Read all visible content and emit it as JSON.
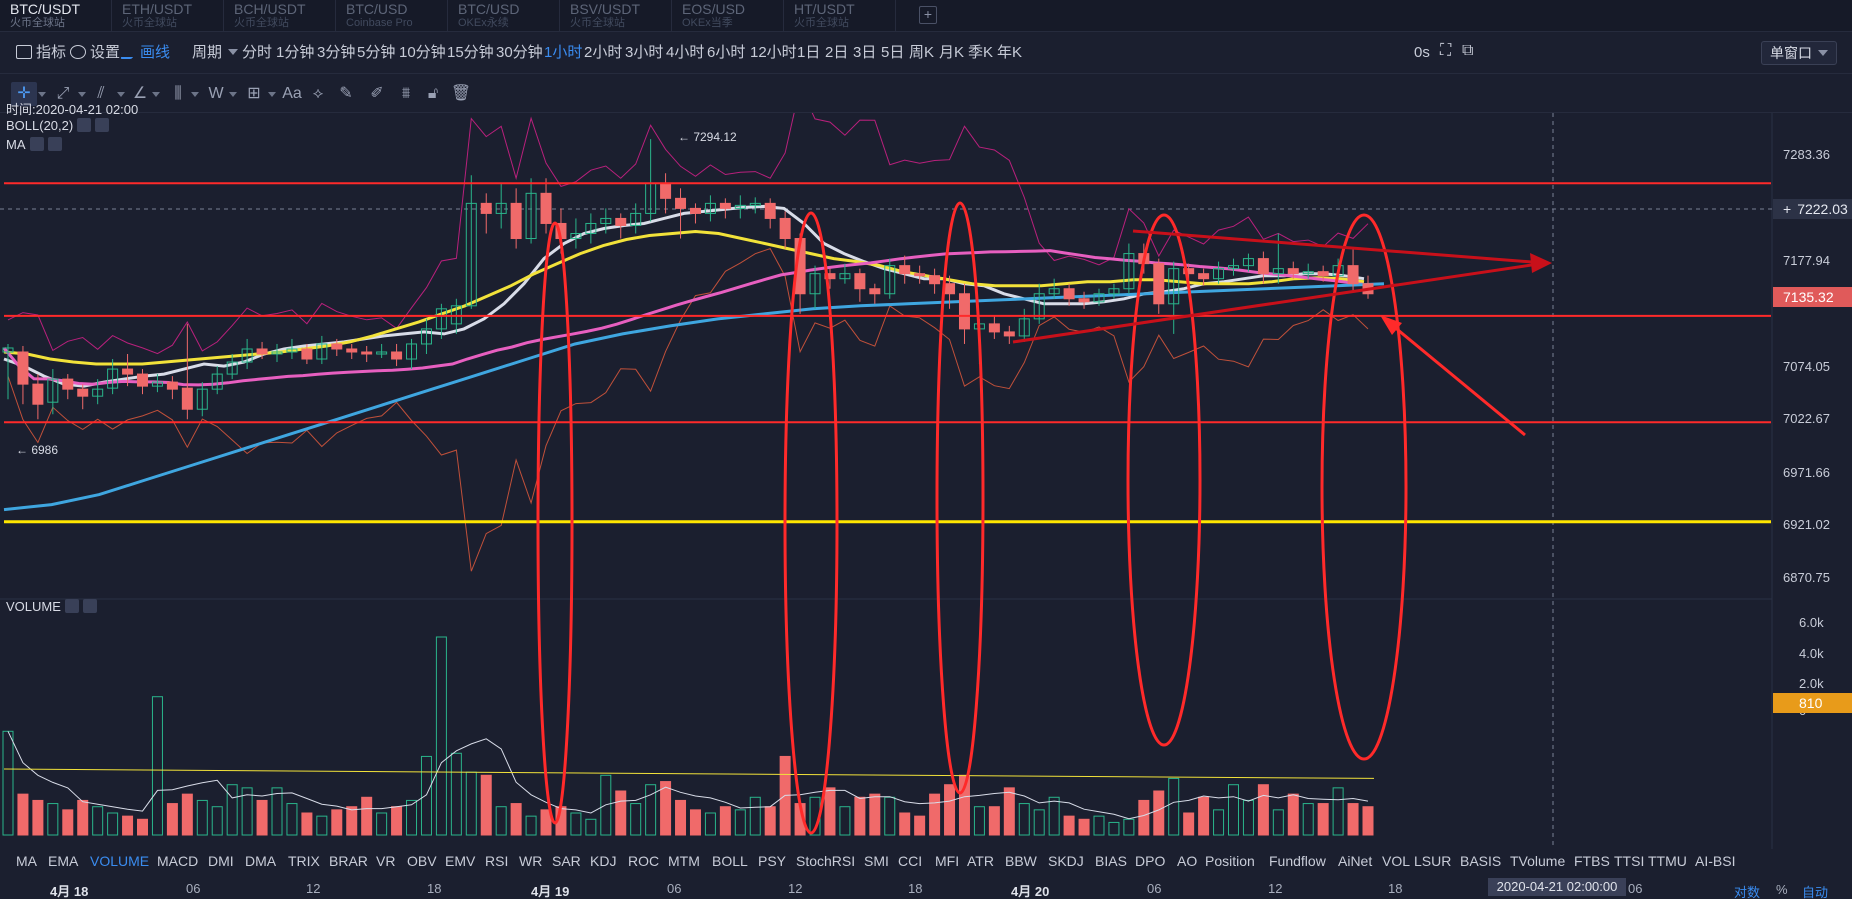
{
  "pair_tabs": [
    {
      "name": "BTC/USDT",
      "sub": "火币全球站",
      "active": true
    },
    {
      "name": "ETH/USDT",
      "sub": "火币全球站",
      "active": false
    },
    {
      "name": "BCH/USDT",
      "sub": "火币全球站",
      "active": false
    },
    {
      "name": "BTC/USD",
      "sub": "Coinbase Pro",
      "active": false
    },
    {
      "name": "BTC/USD",
      "sub": "OKEx永续",
      "active": false
    },
    {
      "name": "BSV/USDT",
      "sub": "火币全球站",
      "active": false
    },
    {
      "name": "EOS/USD",
      "sub": "OKEx当季",
      "active": false
    },
    {
      "name": "HT/USDT",
      "sub": "火币全球站",
      "active": false
    }
  ],
  "add_tab_label": "+",
  "toolbar": {
    "indicators_label": "指标",
    "settings_label": "设置",
    "draw_label": "画线",
    "period_label": "周期",
    "intervals": [
      "分时",
      "1分钟",
      "3分钟",
      "5分钟",
      "10分钟",
      "15分钟",
      "30分钟",
      "1小时",
      "2小时",
      "3小时",
      "4小时",
      "6小时",
      "12小时",
      "1日",
      "2日",
      "3日",
      "5日",
      "周K",
      "月K",
      "季K",
      "年K"
    ],
    "active_interval": "1小时",
    "countdown": "0s",
    "layout_label": "单窗口"
  },
  "draw_tools": [
    "crosshair",
    "trend-line",
    "parallel-lines",
    "angle",
    "candle-pattern",
    "wave",
    "measure",
    "text",
    "shapes",
    "ruler",
    "brush",
    "fibonacci",
    "lock",
    "trash"
  ],
  "overlay": {
    "time_label": "时间:2020-04-21 02:00",
    "boll_label": "BOLL(20,2)",
    "ma_label": "MA",
    "volume_label": "VOLUME",
    "high_label": "← 7294.12",
    "low_label": "← 6986"
  },
  "price_axis": {
    "ticks": [
      "7283.36",
      "7230.46",
      "7177.94",
      "7125.31",
      "7074.05",
      "7022.67",
      "6971.66",
      "6921.02",
      "6870.75"
    ],
    "cursor_price": "7222.03",
    "last_price": "7135.32",
    "volume_ticks": [
      "6.0k",
      "4.0k",
      "2.0k",
      "0"
    ],
    "volume_badge": "810"
  },
  "indicator_tabs": [
    "MA",
    "EMA",
    "VOLUME",
    "MACD",
    "DMI",
    "DMA",
    "TRIX",
    "BRAR",
    "VR",
    "OBV",
    "EMV",
    "RSI",
    "WR",
    "SAR",
    "KDJ",
    "ROC",
    "MTM",
    "BOLL",
    "PSY",
    "StochRSI",
    "SMI",
    "CCI",
    "MFI",
    "ATR",
    "BBW",
    "SKDJ",
    "BIAS",
    "DPO",
    "AO",
    "Position",
    "Fundflow",
    "AiNet",
    "VOL",
    "LSUR",
    "BASIS",
    "TVolume",
    "FTBS",
    "TTSI",
    "TTMU",
    "AI-BSI"
  ],
  "active_indicator": "VOLUME",
  "time_axis": {
    "ticks": [
      "4月 18",
      "06",
      "12",
      "18",
      "4月 19",
      "06",
      "12",
      "18",
      "4月 20",
      "06",
      "12",
      "18",
      "06"
    ],
    "cursor_time": "2020-04-21 02:00:00",
    "log_label": "对数",
    "percent_label": "%",
    "auto_label": "自动"
  },
  "colors": {
    "background": "#1b1f2f",
    "up": "#2ab58b",
    "down": "#f06a6a",
    "accent": "#3a8cf0",
    "annotation": "#ff2a2a",
    "ma_white": "#d8dce8",
    "ma_yellow": "#f2e23a",
    "ma_pink": "#e75fc0",
    "ma_blue": "#3fa6e0",
    "boll": "#b8207c"
  },
  "chart_data": {
    "type": "candlestick",
    "interval": "1小时",
    "price_range": [
      6840,
      7320
    ],
    "candles": [
      [
        7082,
        7086,
        7035,
        7090
      ],
      [
        7082,
        7050,
        7030,
        7088
      ],
      [
        7050,
        7030,
        7015,
        7060
      ],
      [
        7032,
        7055,
        7020,
        7065
      ],
      [
        7055,
        7045,
        7035,
        7060
      ],
      [
        7045,
        7038,
        7025,
        7050
      ],
      [
        7038,
        7045,
        7030,
        7055
      ],
      [
        7046,
        7065,
        7040,
        7075
      ],
      [
        7065,
        7060,
        7048,
        7080
      ],
      [
        7060,
        7048,
        7040,
        7065
      ],
      [
        7048,
        7052,
        7042,
        7060
      ],
      [
        7052,
        7045,
        7035,
        7058
      ],
      [
        7046,
        7025,
        7015,
        7110
      ],
      [
        7025,
        7045,
        7018,
        7052
      ],
      [
        7045,
        7060,
        7040,
        7068
      ],
      [
        7060,
        7072,
        7055,
        7080
      ],
      [
        7072,
        7085,
        7065,
        7095
      ],
      [
        7085,
        7080,
        7075,
        7092
      ],
      [
        7080,
        7082,
        7072,
        7090
      ],
      [
        7082,
        7085,
        7075,
        7095
      ],
      [
        7085,
        7075,
        7070,
        7090
      ],
      [
        7075,
        7090,
        7070,
        7098
      ],
      [
        7090,
        7085,
        7078,
        7095
      ],
      [
        7085,
        7082,
        7075,
        7090
      ],
      [
        7082,
        7080,
        7072,
        7088
      ],
      [
        7080,
        7082,
        7076,
        7090
      ],
      [
        7082,
        7075,
        7068,
        7090
      ],
      [
        7075,
        7090,
        7065,
        7095
      ],
      [
        7090,
        7105,
        7080,
        7115
      ],
      [
        7105,
        7125,
        7095,
        7130
      ],
      [
        7110,
        7128,
        7100,
        7135
      ],
      [
        7128,
        7230,
        7125,
        7258
      ],
      [
        7230,
        7220,
        7200,
        7240
      ],
      [
        7220,
        7230,
        7205,
        7250
      ],
      [
        7230,
        7195,
        7185,
        7245
      ],
      [
        7195,
        7240,
        7190,
        7255
      ],
      [
        7240,
        7210,
        7200,
        7255
      ],
      [
        7210,
        7195,
        7180,
        7225
      ],
      [
        7195,
        7200,
        7185,
        7215
      ],
      [
        7200,
        7210,
        7190,
        7220
      ],
      [
        7210,
        7215,
        7200,
        7225
      ],
      [
        7215,
        7208,
        7195,
        7220
      ],
      [
        7208,
        7220,
        7200,
        7230
      ],
      [
        7220,
        7250,
        7212,
        7294
      ],
      [
        7250,
        7235,
        7220,
        7260
      ],
      [
        7235,
        7225,
        7195,
        7245
      ],
      [
        7225,
        7220,
        7210,
        7230
      ],
      [
        7220,
        7230,
        7212,
        7238
      ],
      [
        7230,
        7225,
        7215,
        7235
      ],
      [
        7225,
        7228,
        7215,
        7238
      ],
      [
        7228,
        7230,
        7220,
        7236
      ],
      [
        7230,
        7215,
        7205,
        7235
      ],
      [
        7215,
        7195,
        7185,
        7222
      ],
      [
        7195,
        7140,
        7120,
        7200
      ],
      [
        7140,
        7160,
        7125,
        7168
      ],
      [
        7160,
        7155,
        7145,
        7165
      ],
      [
        7155,
        7160,
        7150,
        7170
      ],
      [
        7160,
        7145,
        7132,
        7165
      ],
      [
        7145,
        7140,
        7130,
        7150
      ],
      [
        7140,
        7168,
        7135,
        7175
      ],
      [
        7168,
        7160,
        7150,
        7178
      ],
      [
        7160,
        7158,
        7150,
        7168
      ],
      [
        7158,
        7150,
        7140,
        7165
      ],
      [
        7150,
        7140,
        7125,
        7158
      ],
      [
        7140,
        7105,
        7090,
        7150
      ],
      [
        7105,
        7110,
        7070,
        7115
      ],
      [
        7110,
        7102,
        7095,
        7118
      ],
      [
        7102,
        7098,
        7090,
        7108
      ],
      [
        7098,
        7115,
        7092,
        7125
      ],
      [
        7115,
        7140,
        7110,
        7150
      ],
      [
        7140,
        7145,
        7135,
        7155
      ],
      [
        7145,
        7135,
        7128,
        7150
      ],
      [
        7135,
        7132,
        7125,
        7142
      ],
      [
        7132,
        7140,
        7128,
        7145
      ],
      [
        7140,
        7145,
        7135,
        7150
      ],
      [
        7145,
        7180,
        7140,
        7190
      ],
      [
        7180,
        7170,
        7160,
        7190
      ],
      [
        7170,
        7130,
        7120,
        7175
      ],
      [
        7130,
        7165,
        7100,
        7172
      ],
      [
        7165,
        7160,
        7150,
        7170
      ],
      [
        7160,
        7155,
        7148,
        7165
      ],
      [
        7155,
        7165,
        7150,
        7172
      ],
      [
        7165,
        7168,
        7158,
        7175
      ],
      [
        7168,
        7175,
        7162,
        7180
      ],
      [
        7175,
        7160,
        7150,
        7182
      ],
      [
        7160,
        7165,
        7150,
        7200
      ],
      [
        7165,
        7160,
        7155,
        7172
      ],
      [
        7160,
        7162,
        7155,
        7170
      ],
      [
        7162,
        7158,
        7152,
        7168
      ],
      [
        7158,
        7168,
        7154,
        7175
      ],
      [
        7168,
        7150,
        7142,
        7185
      ],
      [
        7150,
        7140,
        7135,
        7158
      ]
    ],
    "volume_k": [
      3.3,
      1.3,
      1.1,
      1.0,
      0.8,
      1.1,
      0.9,
      0.7,
      0.6,
      0.5,
      4.4,
      1.0,
      1.3,
      1.1,
      0.9,
      1.6,
      1.5,
      1.1,
      1.5,
      1.0,
      0.7,
      0.6,
      0.8,
      0.9,
      1.2,
      0.7,
      0.9,
      1.1,
      2.5,
      6.3,
      2.6,
      2.0,
      1.9,
      0.9,
      1.0,
      0.6,
      0.8,
      0.9,
      0.7,
      0.5,
      1.9,
      1.4,
      1.0,
      1.6,
      1.7,
      1.1,
      0.8,
      0.7,
      0.9,
      0.8,
      1.2,
      0.9,
      2.5,
      1.0,
      1.2,
      1.5,
      0.9,
      1.2,
      1.3,
      1.2,
      0.7,
      0.6,
      1.3,
      1.6,
      1.9,
      0.9,
      0.9,
      1.5,
      1.0,
      0.8,
      1.2,
      0.6,
      0.5,
      0.6,
      0.4,
      0.5,
      1.1,
      1.4,
      1.8,
      0.7,
      1.2,
      0.8,
      1.6,
      1.1,
      1.6,
      0.8,
      1.3,
      1.0,
      1.0,
      1.5,
      1.0,
      0.9
    ],
    "series": [
      {
        "type": "line",
        "values": [
          7075,
          7068,
          7058,
          7050,
          7048,
          7052,
          7055,
          7058,
          7060,
          7065,
          7070,
          7068,
          7072,
          7080,
          7085,
          7088,
          7090,
          7092,
          7095,
          7098,
          7100,
          7102,
          7100,
          7105,
          7115,
          7130,
          7150,
          7175,
          7190,
          7200,
          7205,
          7208,
          7210,
          7215,
          7220,
          7222,
          7224,
          7226,
          7227,
          7225,
          7210,
          7190,
          7180,
          7172,
          7165,
          7160,
          7155,
          7155,
          7150,
          7148,
          7140,
          7135,
          7130,
          7130,
          7130,
          7132,
          7135,
          7140,
          7142,
          7145,
          7150,
          7152,
          7155,
          7158,
          7158,
          7160,
          7160,
          7158,
          7155
        ]
      },
      {
        "type": "line",
        "values": [
          7082,
          7080,
          7075,
          7072,
          7070,
          7070,
          7070,
          7072,
          7074,
          7076,
          7078,
          7080,
          7082,
          7085,
          7088,
          7092,
          7098,
          7105,
          7112,
          7120,
          7128,
          7138,
          7148,
          7160,
          7170,
          7180,
          7188,
          7194,
          7198,
          7200,
          7202,
          7200,
          7195,
          7190,
          7185,
          7180,
          7175,
          7172,
          7168,
          7162,
          7158,
          7154,
          7150,
          7148,
          7148,
          7148,
          7150,
          7152,
          7152,
          7154,
          7154,
          7152,
          7150,
          7150,
          7150,
          7152,
          7155,
          7156,
          7155,
          7152
        ]
      },
      {
        "type": "line",
        "values": [
          6925,
          6930,
          6940,
          6955,
          6970,
          6985,
          7000,
          7015,
          7030,
          7045,
          7060,
          7075,
          7090,
          7100,
          7108,
          7115,
          7120,
          7125,
          7128,
          7130,
          7132,
          7134,
          7136,
          7138,
          7140,
          7142,
          7144,
          7146,
          7148,
          7150
        ]
      }
    ],
    "annotations": {
      "horizontal_levels": [
        7250,
        7118,
        7012
      ],
      "yellow_level": 6913
    }
  }
}
